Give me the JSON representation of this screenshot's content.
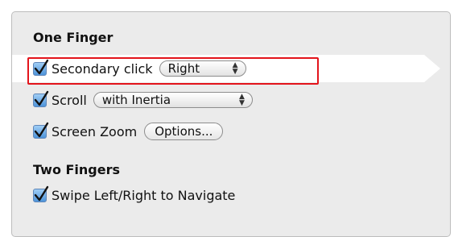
{
  "one_finger": {
    "title": "One Finger",
    "secondary_click": {
      "label": "Secondary click",
      "checked": true,
      "value": "Right"
    },
    "scroll": {
      "label": "Scroll",
      "checked": true,
      "value": "with Inertia"
    },
    "screen_zoom": {
      "label": "Screen Zoom",
      "checked": true,
      "button_label": "Options..."
    }
  },
  "two_fingers": {
    "title": "Two Fingers",
    "swipe": {
      "label": "Swipe Left/Right to Navigate",
      "checked": true
    }
  },
  "colors": {
    "highlight_border": "#e3141b",
    "checkbox": "#4e94da"
  }
}
